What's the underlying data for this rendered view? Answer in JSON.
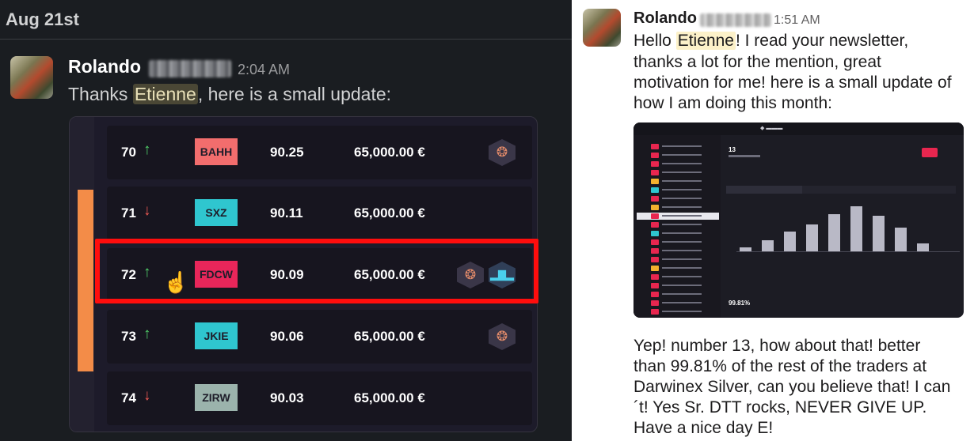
{
  "left_panel": {
    "date": "Aug 21st",
    "message": {
      "sender": "Rolando",
      "time": "2:04 AM",
      "text_before": "Thanks ",
      "mention": "Etienne",
      "text_after": ", here is a small update:"
    },
    "leaderboard": [
      {
        "rank": "70",
        "trend": "up",
        "arrow": "↑",
        "ticker": "BAHH",
        "ticker_color": "#f26d6d",
        "score": "90.25",
        "amount": "65,000.00 €",
        "badges": [
          "wreath"
        ]
      },
      {
        "rank": "71",
        "trend": "down",
        "arrow": "↓",
        "ticker": "SXZ",
        "ticker_color": "#2fc6cf",
        "score": "90.11",
        "amount": "65,000.00 €",
        "badges": []
      },
      {
        "rank": "72",
        "trend": "up",
        "arrow": "↑",
        "ticker": "FDCW",
        "ticker_color": "#e8265a",
        "score": "90.09",
        "amount": "65,000.00 €",
        "badges": [
          "wreath",
          "chart"
        ]
      },
      {
        "rank": "73",
        "trend": "up",
        "arrow": "↑",
        "ticker": "JKIE",
        "ticker_color": "#2fc6cf",
        "score": "90.06",
        "amount": "65,000.00 €",
        "badges": [
          "wreath"
        ]
      },
      {
        "rank": "74",
        "trend": "down",
        "arrow": "↓",
        "ticker": "ZIRW",
        "ticker_color": "#9bb3ac",
        "score": "90.03",
        "amount": "65,000.00 €",
        "badges": []
      }
    ],
    "highlight_color": "#ff0d0d",
    "cursor_icon": "hand-pointer-icon"
  },
  "right_panel": {
    "message": {
      "sender": "Rolando",
      "time": "1:51 AM",
      "line1_before": "Hello ",
      "mention": "Etienne",
      "line1_after": "! I read your newsletter,",
      "line2": "thanks a lot for the mention, great",
      "line3": "motivation for me! here is a small update of",
      "line4": "how I am doing this month:"
    },
    "screenshot": {
      "rank_text": "13",
      "percentile_text": "99.81%"
    },
    "reply_lines": [
      "Yep! number 13, how about that! better",
      "than 99.81% of the rest of the traders at",
      "Darwinex Silver, can you believe that! I can",
      "´t! Yes Sr. DTT rocks, NEVER GIVE UP.",
      "Have a nice day E!"
    ]
  }
}
